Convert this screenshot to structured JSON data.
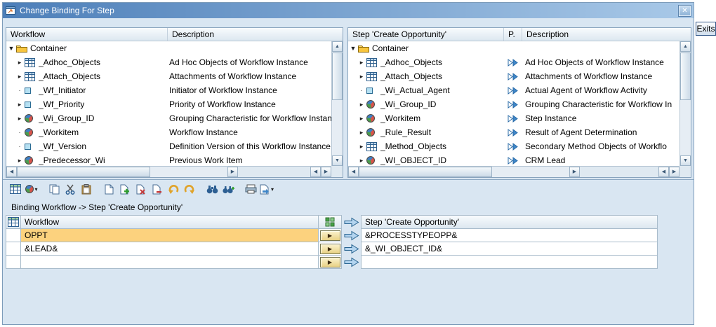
{
  "window": {
    "title": "Change Binding For Step",
    "close_glyph": "✕"
  },
  "exits": {
    "label": "Exits"
  },
  "glyphs": {
    "up": "▲",
    "down": "▼",
    "left": "◀",
    "right": "▶",
    "row_button": "▶",
    "dropdown": "▾"
  },
  "left_panel": {
    "col1": "Workflow",
    "col2": "Description",
    "root": "Container",
    "root_tw": "▼",
    "items": [
      {
        "name": "_Adhoc_Objects",
        "desc": "Ad Hoc Objects of Workflow Instance",
        "icon": "multiline-container",
        "tw": "▸"
      },
      {
        "name": "_Attach_Objects",
        "desc": "Attachments of Workflow Instance",
        "icon": "multiline-container",
        "tw": "▸"
      },
      {
        "name": "_Wf_Initiator",
        "desc": "Initiator of Workflow Instance",
        "icon": "element",
        "tw": "·"
      },
      {
        "name": "_Wf_Priority",
        "desc": "Priority of Workflow Instance",
        "icon": "element",
        "tw": "▸"
      },
      {
        "name": "_Wi_Group_ID",
        "desc": "Grouping Characteristic for Workflow Instan",
        "icon": "object",
        "tw": "▸"
      },
      {
        "name": "_Workitem",
        "desc": "Workflow Instance",
        "icon": "object",
        "tw": "·"
      },
      {
        "name": "_Wf_Version",
        "desc": "Definition Version of this Workflow Instance",
        "icon": "element",
        "tw": "·"
      },
      {
        "name": "_Predecessor_Wi",
        "desc": "Previous Work Item",
        "icon": "object",
        "tw": "▸"
      }
    ]
  },
  "right_panel": {
    "col1": "Step 'Create Opportunity'",
    "col2": "P.",
    "col3": "Description",
    "root": "Container",
    "root_tw": "▼",
    "items": [
      {
        "name": "_Adhoc_Objects",
        "desc": "Ad Hoc Objects of Workflow Instance",
        "icon": "multiline-container",
        "tw": "▸"
      },
      {
        "name": "_Attach_Objects",
        "desc": "Attachments of Workflow Instance",
        "icon": "multiline-container",
        "tw": "▸"
      },
      {
        "name": "_Wi_Actual_Agent",
        "desc": "Actual Agent of Workflow Activity",
        "icon": "element",
        "tw": "·"
      },
      {
        "name": "_Wi_Group_ID",
        "desc": "Grouping Characteristic for Workflow In",
        "icon": "object",
        "tw": "▸"
      },
      {
        "name": "_Workitem",
        "desc": "Step Instance",
        "icon": "object",
        "tw": "▸"
      },
      {
        "name": "_Rule_Result",
        "desc": "Result of Agent Determination",
        "icon": "object",
        "tw": "▸"
      },
      {
        "name": "_Method_Objects",
        "desc": "Secondary Method Objects of Workflo",
        "icon": "multiline-container",
        "tw": "▸"
      },
      {
        "name": "_WI_OBJECT_ID",
        "desc": "CRM Lead",
        "icon": "object",
        "tw": "▸"
      }
    ]
  },
  "toolbar": {
    "icons": [
      "choose-detail",
      "display-options",
      "copy",
      "cut",
      "paste",
      "create-line",
      "insert-line",
      "delete-line",
      "remove-line",
      "undo",
      "redo",
      "find",
      "find-next",
      "print",
      "export"
    ]
  },
  "binding": {
    "label": "Binding Workflow  -> Step 'Create Opportunity'",
    "left_header": "Workflow",
    "right_header": "Step 'Create Opportunity'",
    "rows": [
      {
        "source": "OPPT",
        "target": "&PROCESSTYPEOPP&",
        "selected": true
      },
      {
        "source": "&LEAD&",
        "target": "&_WI_OBJECT_ID&",
        "selected": false
      },
      {
        "source": "",
        "target": "",
        "selected": false
      }
    ]
  }
}
